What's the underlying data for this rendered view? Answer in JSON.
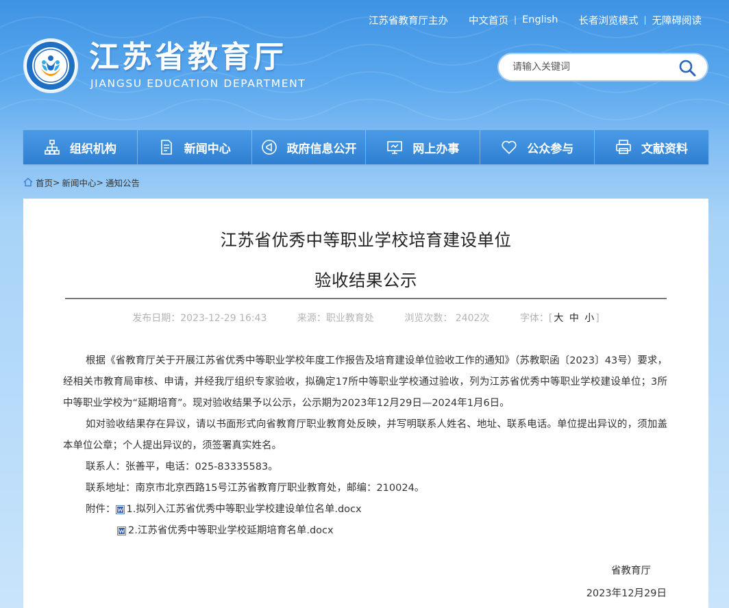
{
  "header": {
    "top_links": {
      "host": "江苏省教育厅主办",
      "home_cn": "中文首页",
      "english": "English",
      "elder_mode": "长者浏览模式",
      "accessibility": "无障碍阅读"
    },
    "brand_cn": "江苏省教育厅",
    "brand_en": "JIANGSU EDUCATION DEPARTMENT",
    "search_placeholder": "请输入关键词"
  },
  "nav": {
    "items": [
      {
        "label": "组织机构",
        "icon": "org-chart-icon"
      },
      {
        "label": "新闻中心",
        "icon": "document-icon"
      },
      {
        "label": "政府信息公开",
        "icon": "bullhorn-icon"
      },
      {
        "label": "网上办事",
        "icon": "monitor-icon"
      },
      {
        "label": "公众参与",
        "icon": "heart-icon"
      },
      {
        "label": "文献资料",
        "icon": "printer-icon"
      }
    ]
  },
  "breadcrumb": {
    "home": "首页",
    "sep1": ">",
    "news": "新闻中心",
    "sep2": ">",
    "current": "通知公告"
  },
  "article": {
    "title_line1": "江苏省优秀中等职业学校培育建设单位",
    "title_line2": "验收结果公示",
    "meta": {
      "published": "发布日期：2023-12-29 16:43",
      "source": "来源：职业教育处",
      "views": "浏览次数： 2402次",
      "font_label": "字体：",
      "bracket_open": "[",
      "size_large": "大",
      "size_medium": "中",
      "size_small": "小",
      "bracket_close": "]"
    },
    "paragraphs": [
      "根据《省教育厅关于开展江苏省优秀中等职业学校年度工作报告及培育建设单位验收工作的通知》（苏教职函〔2023〕43号）要求，经相关市教育局审核、申请，并经我厅组织专家验收，拟确定17所中等职业学校通过验收，列为江苏省优秀中等职业学校建设单位；3所中等职业学校为“延期培育”。现对验收结果予以公示，公示期为2023年12月29日—2024年1月6日。",
      "如对验收结果存在异议，请以书面形式向省教育厅职业教育处反映，并写明联系人姓名、地址、联系电话。单位提出异议的，须加盖本单位公章；个人提出异议的，须签署真实姓名。",
      "联系人：张善平，电话：025-83335583。",
      "联系地址：南京市北京西路15号江苏省教育厅职业教育处，邮编：210024。"
    ],
    "attachments_label": "附件：",
    "attachments": [
      "1.拟列入江苏省优秀中等职业学校建设单位名单.docx",
      "2.江苏省优秀中等职业学校延期培育名单.docx"
    ],
    "signature_org": "省教育厅",
    "signature_date": "2023年12月29日"
  },
  "colors": {
    "nav_bg": "#3a8bdc",
    "header_bg": "#3e93e3",
    "page_bg_bottom": "#c9e4fb"
  }
}
